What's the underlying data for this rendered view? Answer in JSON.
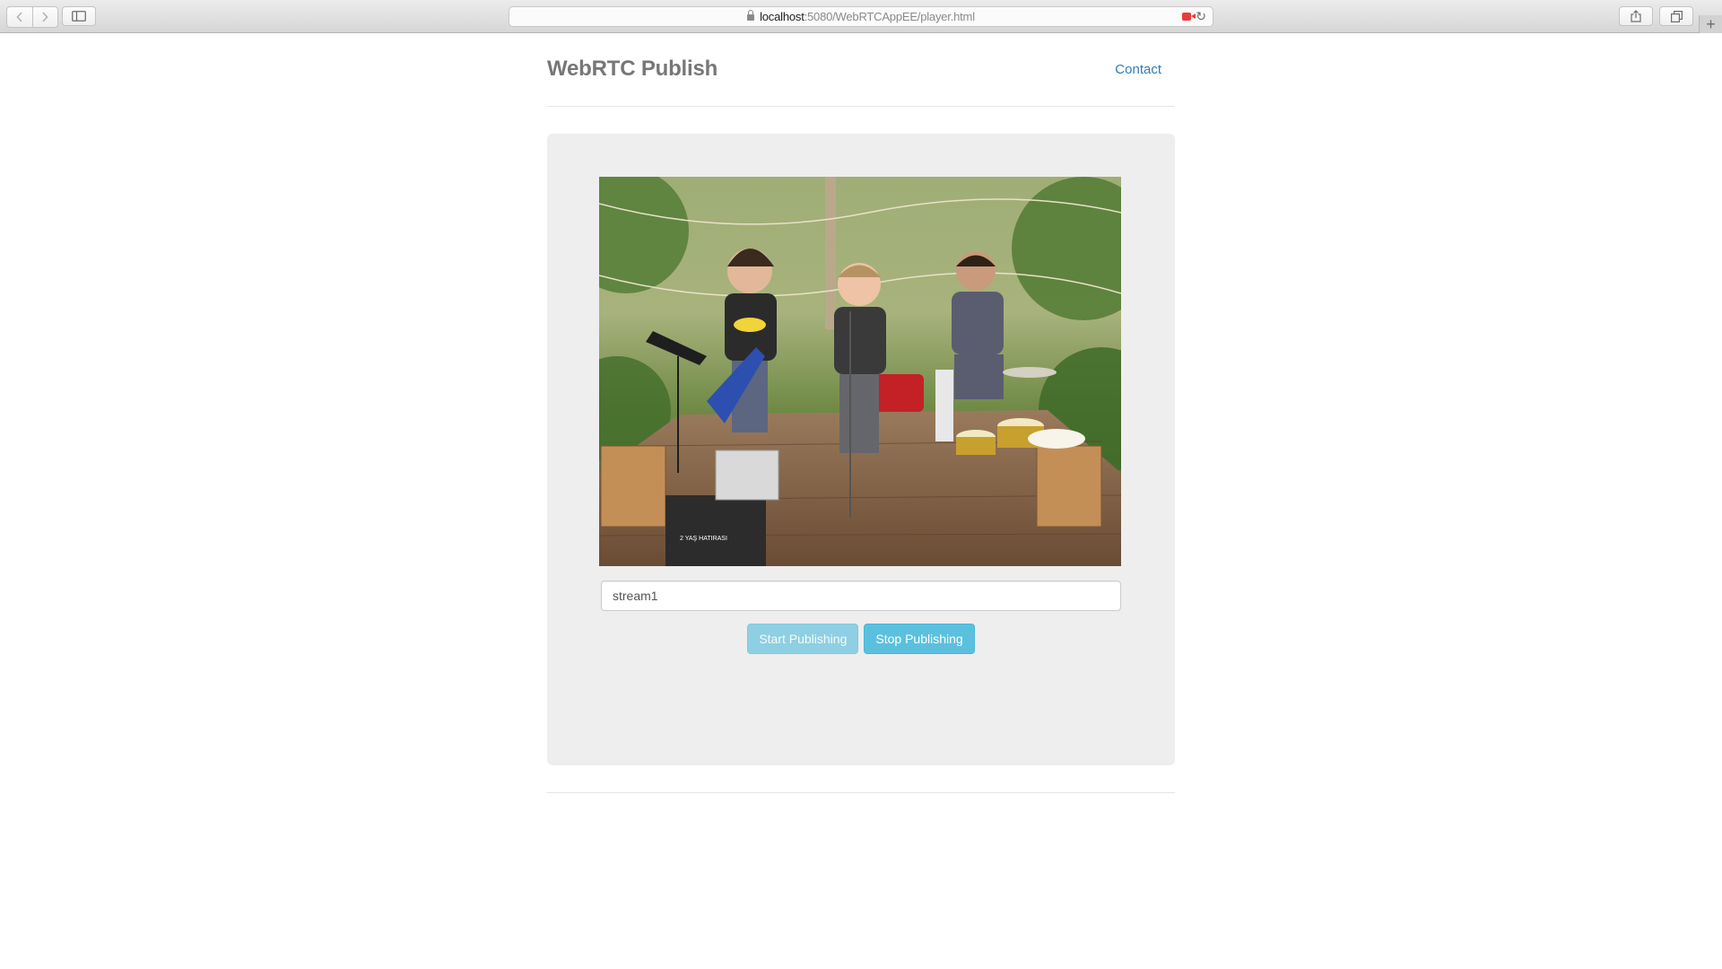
{
  "browser": {
    "url_host": "localhost",
    "url_rest": ":5080/WebRTCAppEE/player.html",
    "back_icon": "chevron-left-icon",
    "forward_icon": "chevron-right-icon",
    "sidebar_icon": "sidebar-icon",
    "share_icon": "share-icon",
    "tabs_icon": "tabs-icon",
    "new_tab_icon": "plus-icon",
    "recording_icon": "camera-recording-icon",
    "reload_icon": "reload-icon"
  },
  "header": {
    "brand": "WebRTC Publish",
    "nav_contact": "Contact"
  },
  "publisher": {
    "stream_name_value": "stream1",
    "start_button": "Start Publishing",
    "stop_button": "Stop Publishing",
    "video_overlay_text": "2 YAŞ HATIRASI"
  },
  "colors": {
    "accent": "#5bc0de",
    "link": "#337ab7",
    "panel": "#eeeeee",
    "brand_text": "#777777",
    "recording": "#ea3b3b"
  }
}
